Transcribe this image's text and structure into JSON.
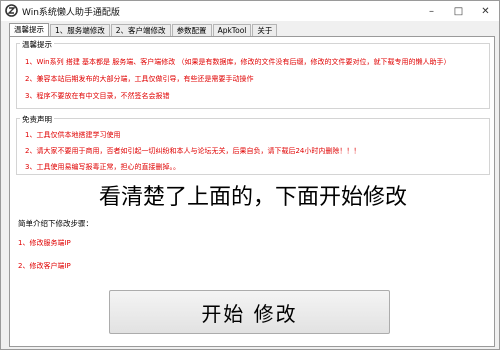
{
  "window": {
    "title": "Win系统懒人助手通配版",
    "controls": {
      "minimize": "–",
      "maximize": "□",
      "close": "✕"
    }
  },
  "tabs": [
    {
      "label": "温馨提示",
      "active": true
    },
    {
      "label": "1、服务端修改",
      "active": false
    },
    {
      "label": "2、客户端修改",
      "active": false
    },
    {
      "label": "参数配置",
      "active": false
    },
    {
      "label": "ApkTool",
      "active": false
    },
    {
      "label": "关于",
      "active": false
    }
  ],
  "tips": {
    "title": "温馨提示",
    "lines": [
      "1、Win系列 搭建 基本都是 服务端、客户端修改 （如果是有数据库，修改的文件没有后缀，修改的文件要对位，就下载专用的懒人助手）",
      "2、兼容本站后期发布的大部分端，工具仅做引导，有些还是需要手动操作",
      "3、程序不要放在有中文目录，不然签名会报错"
    ]
  },
  "disclaimer": {
    "title": "免责声明",
    "lines": [
      "1、工具仅供本地搭建学习使用",
      "2、请大家不要用于商用，否者如引起一切纠纷和本人与论坛无关，后果自负，请下载后24小时内删除！！！",
      "3、工具使用易编写报毒正常，担心的直接删掉。。"
    ]
  },
  "notice": "看清楚了上面的，下面开始修改",
  "steps": {
    "title": "简单介绍下修改步骤：",
    "items": [
      "1、修改服务端IP",
      "2、修改客户端IP"
    ]
  },
  "start_button": "开始 修改",
  "colors": {
    "warning_red": "#e00000",
    "panel_bg": "#ffffff",
    "window_bg": "#f0f0f0"
  }
}
